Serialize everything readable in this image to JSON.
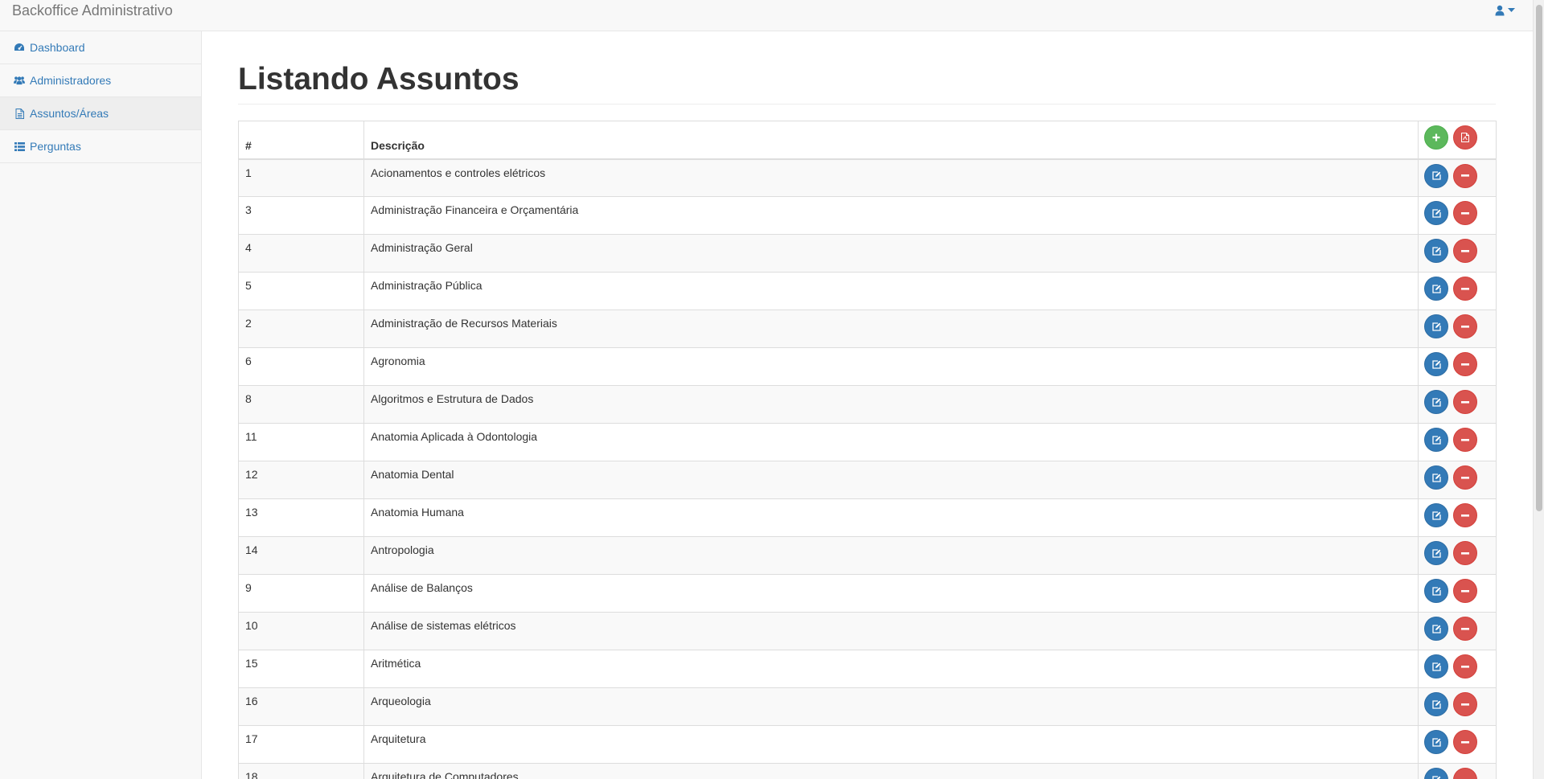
{
  "navbar": {
    "brand": "Backoffice Administrativo",
    "user_icon": "user-icon",
    "caret_icon": "caret-down-icon"
  },
  "sidebar": {
    "items": [
      {
        "label": "Dashboard",
        "icon": "dashboard-icon",
        "active": false
      },
      {
        "label": "Administradores",
        "icon": "users-icon",
        "active": false
      },
      {
        "label": "Assuntos/Áreas",
        "icon": "file-icon",
        "active": true
      },
      {
        "label": "Perguntas",
        "icon": "list-icon",
        "active": false
      }
    ]
  },
  "main": {
    "title": "Listando Assuntos",
    "table": {
      "columns": [
        "#",
        "Descrição"
      ],
      "header_actions": {
        "add_icon": "plus-icon",
        "pdf_icon": "file-pdf-icon"
      },
      "row_actions": {
        "edit_icon": "edit-icon",
        "delete_icon": "minus-icon"
      },
      "rows": [
        {
          "id": "1",
          "desc": "Acionamentos e controles elétricos"
        },
        {
          "id": "3",
          "desc": "Administração Financeira e Orçamentária"
        },
        {
          "id": "4",
          "desc": "Administração Geral"
        },
        {
          "id": "5",
          "desc": "Administração Pública"
        },
        {
          "id": "2",
          "desc": "Administração de Recursos Materiais"
        },
        {
          "id": "6",
          "desc": "Agronomia"
        },
        {
          "id": "8",
          "desc": "Algoritmos e Estrutura de Dados"
        },
        {
          "id": "11",
          "desc": "Anatomia Aplicada à Odontologia"
        },
        {
          "id": "12",
          "desc": "Anatomia Dental"
        },
        {
          "id": "13",
          "desc": "Anatomia Humana"
        },
        {
          "id": "14",
          "desc": "Antropologia"
        },
        {
          "id": "9",
          "desc": "Análise de Balanços"
        },
        {
          "id": "10",
          "desc": "Análise de sistemas elétricos"
        },
        {
          "id": "15",
          "desc": "Aritmética"
        },
        {
          "id": "16",
          "desc": "Arqueologia"
        },
        {
          "id": "17",
          "desc": "Arquitetura"
        },
        {
          "id": "18",
          "desc": "Arquitetura de Computadores"
        }
      ]
    }
  },
  "colors": {
    "link": "#337ab7",
    "success": "#5cb85c",
    "danger": "#d9534f",
    "primary": "#337ab7"
  }
}
